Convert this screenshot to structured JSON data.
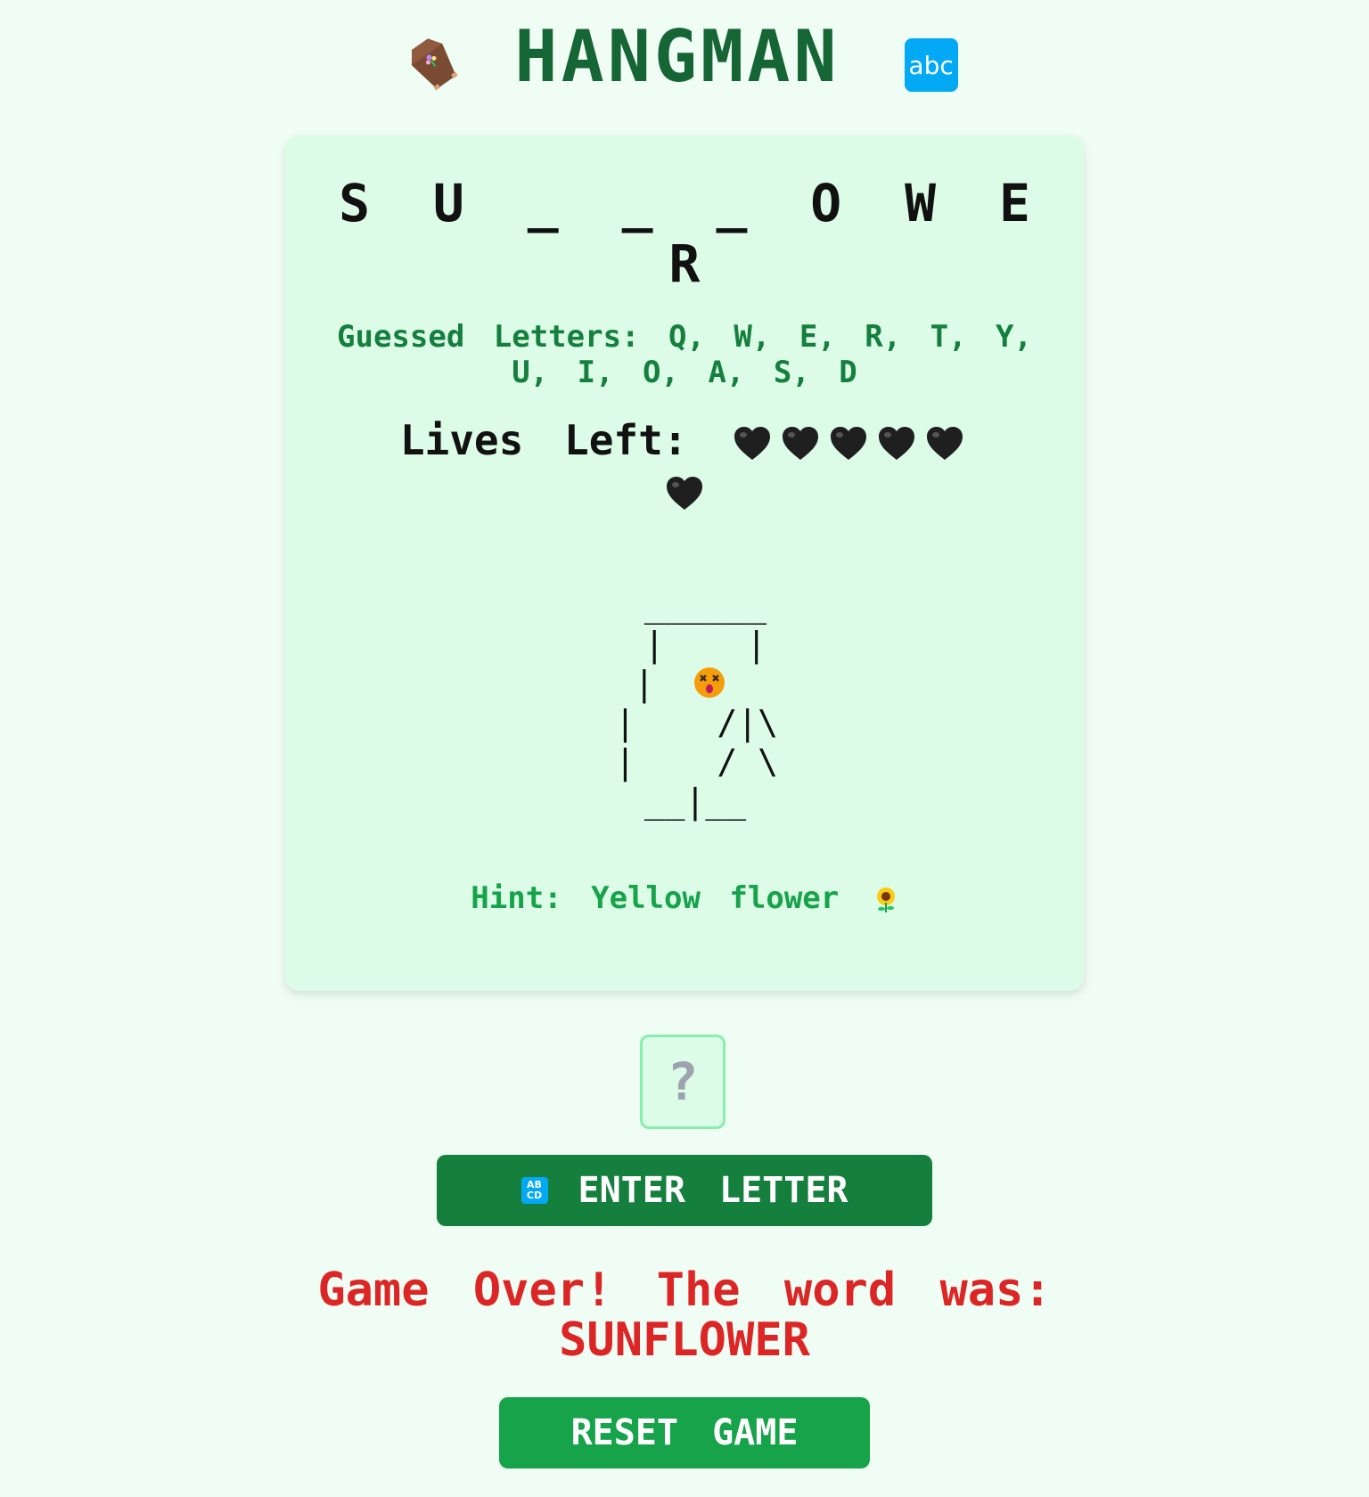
{
  "header": {
    "title": "HANGMAN",
    "left_icon": "coffin-icon",
    "right_icon": "abc-icon",
    "right_icon_text": "abc"
  },
  "game": {
    "word_display": "S U _ _ _ O W E R",
    "guessed_label": "Guessed Letters:",
    "guessed_letters": "Q, W, E, R, T, Y, U, I, O, A, S, D",
    "lives_label": "Lives Left:",
    "lives_remaining": 6,
    "life_icon": "black-heart-icon",
    "gallows_art": " ______\n |    |\n|     \n|    /|\\\n|    / \\\n__|__",
    "head_icon": "dizzy-face-icon",
    "hint_label": "Hint:",
    "hint_text": "Yellow flower",
    "hint_icon": "sunflower-icon"
  },
  "input": {
    "placeholder": "?"
  },
  "enter_button": {
    "icon": "abcd-icon",
    "icon_text": "AB CD",
    "label": "ENTER LETTER"
  },
  "status": {
    "message": "Game Over! The word was: SUNFLOWER"
  },
  "reset_button": {
    "label": "RESET GAME"
  },
  "colors": {
    "background": "#f0fdf4",
    "card": "#dcfce7",
    "title": "#166534",
    "guessed": "#15803d",
    "hint": "#16a34a",
    "enter_button": "#15803d",
    "reset_button": "#16a34a",
    "game_over": "#dc2626"
  }
}
